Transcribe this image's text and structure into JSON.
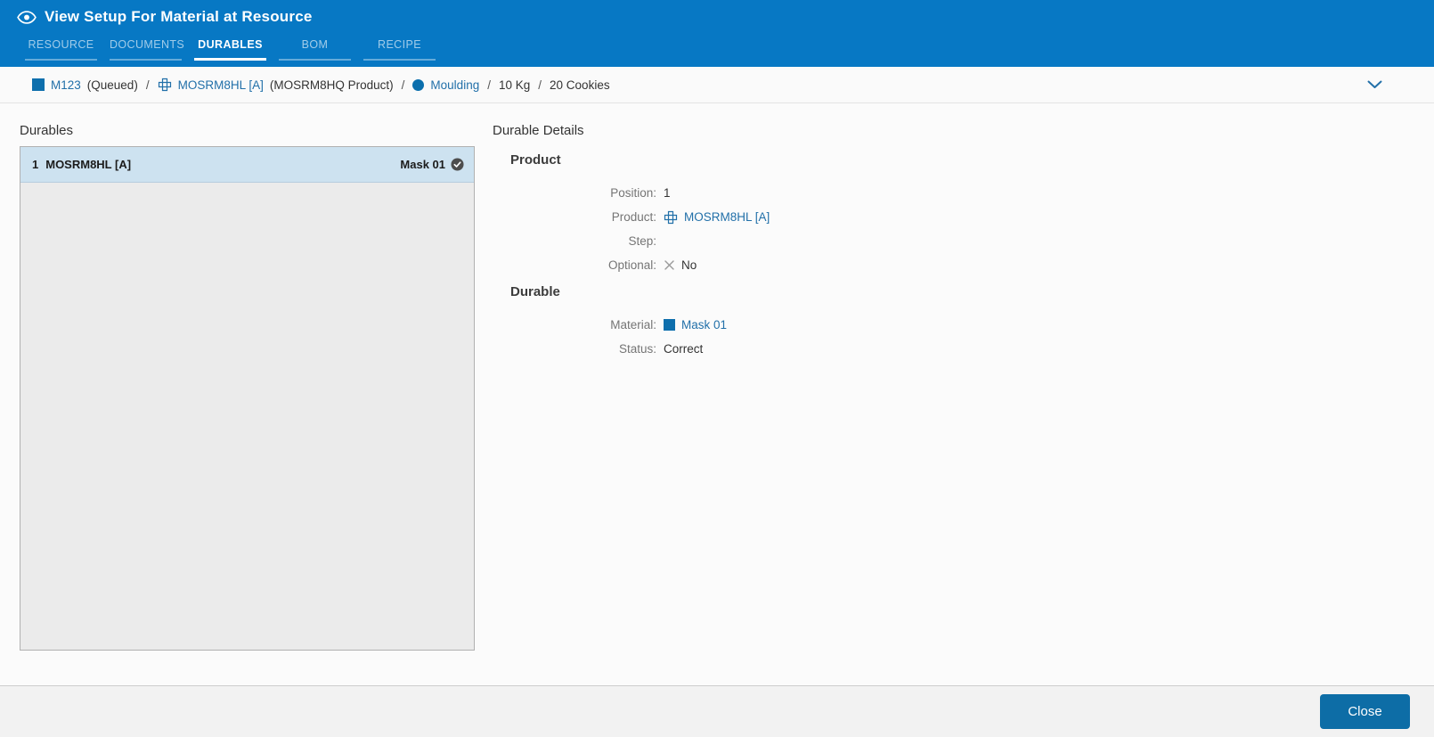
{
  "header": {
    "title": "View Setup For Material at Resource",
    "tabs": [
      "RESOURCE",
      "DOCUMENTS",
      "DURABLES",
      "BOM",
      "RECIPE"
    ],
    "active_tab": "DURABLES"
  },
  "breadcrumb": {
    "material_id": "M123",
    "material_status": "(Queued)",
    "sep": "/",
    "product_id": "MOSRM8HL [A]",
    "product_desc": "(MOSRM8HQ Product)",
    "operation": "Moulding",
    "quantity_primary": "10 Kg",
    "quantity_secondary": "20 Cookies"
  },
  "durables": {
    "title": "Durables",
    "items": [
      {
        "position": "1",
        "product": "MOSRM8HL [A]",
        "durable": "Mask 01",
        "selected": true,
        "status_icon": "check-circle-icon"
      }
    ]
  },
  "details": {
    "title": "Durable Details",
    "product_section": {
      "heading": "Product",
      "position_label": "Position:",
      "position_value": "1",
      "product_label": "Product:",
      "product_value": "MOSRM8HL [A]",
      "step_label": "Step:",
      "step_value": "",
      "optional_label": "Optional:",
      "optional_value": "No"
    },
    "durable_section": {
      "heading": "Durable",
      "material_label": "Material:",
      "material_value": "Mask 01",
      "status_label": "Status:",
      "status_value": "Correct"
    }
  },
  "footer": {
    "close_label": "Close"
  },
  "icons": {
    "eye-icon": "outlined eye (view mode)",
    "material-square-icon": "solid blue square",
    "product-icon": "blue plus-grid outline",
    "operation-circle-icon": "solid blue circle",
    "chevron-down-icon": "blue chevron pointing down",
    "check-circle-icon": "dark gray circle with white checkmark",
    "x-icon": "gray cross (no/false)"
  },
  "colors": {
    "header_blue": "#0778c4",
    "link_blue": "#2270a9",
    "icon_blue": "#0e6fad",
    "selected_row": "#cde2f0",
    "list_background": "#ebebeb",
    "button_blue": "#0d6da6",
    "check_circle_gray": "#4d4d4d"
  }
}
